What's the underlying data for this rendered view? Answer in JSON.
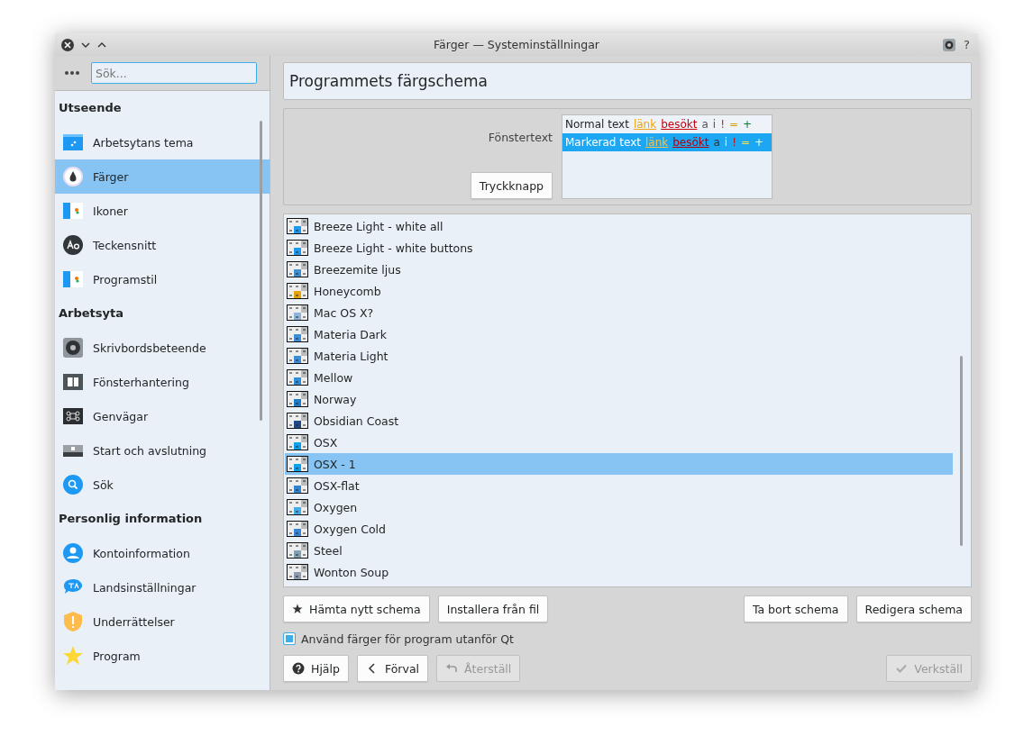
{
  "window": {
    "title": "Färger — Systeminställningar",
    "help": "?"
  },
  "sidebar": {
    "search": {
      "placeholder": "Sök..."
    },
    "sections": [
      {
        "title": "Utseende",
        "items": [
          {
            "label": "Arbetsytans tema",
            "selected": false
          },
          {
            "label": "Färger",
            "selected": true
          },
          {
            "label": "Ikoner",
            "selected": false
          },
          {
            "label": "Teckensnitt",
            "selected": false
          },
          {
            "label": "Programstil",
            "selected": false
          }
        ]
      },
      {
        "title": "Arbetsyta",
        "items": [
          {
            "label": "Skrivbordsbeteende",
            "selected": false
          },
          {
            "label": "Fönsterhantering",
            "selected": false
          },
          {
            "label": "Genvägar",
            "selected": false
          },
          {
            "label": "Start och avslutning",
            "selected": false
          },
          {
            "label": "Sök",
            "selected": false
          }
        ]
      },
      {
        "title": "Personlig information",
        "items": [
          {
            "label": "Kontoinformation",
            "selected": false
          },
          {
            "label": "Landsinställningar",
            "selected": false
          },
          {
            "label": "Underrättelser",
            "selected": false
          },
          {
            "label": "Program",
            "selected": false
          }
        ]
      }
    ]
  },
  "page_title": "Programmets färgschema",
  "preview": {
    "window_text": "Fönstertext",
    "push_button": "Tryckknapp",
    "rows": [
      {
        "selected": false,
        "tokens": [
          {
            "kind": "normal",
            "text": "Normal text"
          },
          {
            "kind": "link",
            "text": "länk"
          },
          {
            "kind": "visited",
            "text": "besökt"
          },
          {
            "kind": "active",
            "text": "a"
          },
          {
            "kind": "inactive",
            "text": "i"
          },
          {
            "kind": "negative",
            "text": "!"
          },
          {
            "kind": "neutral",
            "text": "="
          },
          {
            "kind": "positive",
            "text": "+"
          }
        ]
      },
      {
        "selected": true,
        "tokens": [
          {
            "kind": "normal",
            "text": "Markerad text"
          },
          {
            "kind": "link",
            "text": "länk"
          },
          {
            "kind": "visited",
            "text": "besökt"
          },
          {
            "kind": "active",
            "text": "a"
          },
          {
            "kind": "inactive",
            "text": "i"
          },
          {
            "kind": "negative",
            "text": "!"
          },
          {
            "kind": "neutral",
            "text": "="
          },
          {
            "kind": "positive",
            "text": "+"
          }
        ]
      }
    ]
  },
  "schemes": [
    {
      "name": "Breeze Light - white all",
      "selected": false,
      "color": "#1d99f3"
    },
    {
      "name": "Breeze Light - white buttons",
      "selected": false,
      "color": "#1d99f3"
    },
    {
      "name": "Breezemite ljus",
      "selected": false,
      "color": "#3c8fd0"
    },
    {
      "name": "Honeycomb",
      "selected": false,
      "color": "#e5a50a"
    },
    {
      "name": "Mac OS X?",
      "selected": false,
      "color": "#8fb3d9"
    },
    {
      "name": "Materia Dark",
      "selected": false,
      "color": "#3b8ed8"
    },
    {
      "name": "Materia Light",
      "selected": false,
      "color": "#3b8ed8"
    },
    {
      "name": "Mellow",
      "selected": false,
      "color": "#2f8fd8"
    },
    {
      "name": "Norway",
      "selected": false,
      "color": "#1f7ac7"
    },
    {
      "name": "Obsidian Coast",
      "selected": false,
      "color": "#1e4a86"
    },
    {
      "name": "OSX",
      "selected": false,
      "color": "#0aa0f0"
    },
    {
      "name": "OSX - 1",
      "selected": true,
      "color": "#0aa0f0"
    },
    {
      "name": "OSX-flat",
      "selected": false,
      "color": "#2f86d0"
    },
    {
      "name": "Oxygen",
      "selected": false,
      "color": "#43ace8"
    },
    {
      "name": "Oxygen Cold",
      "selected": false,
      "color": "#3a84d4"
    },
    {
      "name": "Steel",
      "selected": false,
      "color": "#7fa2b2"
    },
    {
      "name": "Wonton Soup",
      "selected": false,
      "color": "#8d9bb0"
    }
  ],
  "scheme_buttons": {
    "left": [
      "Hämta nytt schema",
      "Installera från fil"
    ],
    "right": [
      "Ta bort schema",
      "Redigera schema"
    ]
  },
  "apply_outside_qt": {
    "label": "Använd färger för program utanför Qt",
    "checked": true
  },
  "footer": [
    {
      "label": "Hjälp",
      "kind": "help",
      "disabled": false
    },
    {
      "label": "Förval",
      "kind": "back",
      "disabled": false
    },
    {
      "label": "Återställ",
      "kind": "reset",
      "disabled": true
    },
    {
      "label": "Verkställ",
      "kind": "apply",
      "disabled": true
    }
  ]
}
